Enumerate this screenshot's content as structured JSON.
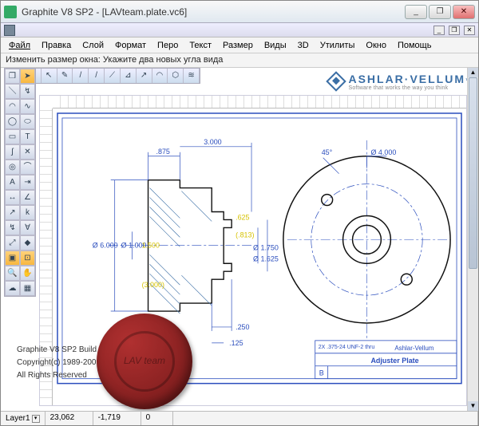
{
  "window": {
    "title": "Graphite V8 SP2 - [LAVteam.plate.vc6]",
    "controls": {
      "min": "_",
      "max": "❐",
      "close": "✕"
    }
  },
  "mdi": {
    "min": "_",
    "restore": "❐",
    "close": "✕"
  },
  "menu": {
    "file": "Файл",
    "edit": "Правка",
    "layer": "Слой",
    "format": "Формат",
    "pen": "Перо",
    "text": "Текст",
    "size": "Размер",
    "views": "Виды",
    "threeD": "3D",
    "utilities": "Утилиты",
    "window": "Окно",
    "help": "Помощь"
  },
  "prompt": "Изменить размер окна: Укажите два новых угла вида",
  "brand": {
    "name": "ASHLAR·VELLUM",
    "tag": "Software that works the way you think",
    "tm": "™"
  },
  "status": {
    "layer_label": "Layer1",
    "x": "23,062",
    "y": "-1,719",
    "z": "0"
  },
  "build": {
    "line1": "Graphite V8 SP2 Build 8.6.4",
    "line2": "Copyright(c) 1989-2009 Ashlar-Vellum",
    "line3": "All Rights Reserved"
  },
  "dims": {
    "d1": ".875",
    "d2": "3.000",
    "d3": "Ø 6.000",
    "d4": "Ø 1.000",
    "d5": "1.500",
    "d6": "(3.000)",
    "d7": ".625",
    "d8": "(.813)",
    "d9": "Ø 1.750",
    "d10": "Ø 1.625",
    "d11": ".250",
    "d12": ".125",
    "d13": "1.00",
    "d14": "45°",
    "d15": "Ø 4.000",
    "tbnote": "2X .375-24 UNF-2  thru",
    "tbcompany": "Ashlar-Vellum",
    "tbtitle": "Adjuster Plate",
    "tbrev": "B"
  },
  "seal": "LAV team"
}
